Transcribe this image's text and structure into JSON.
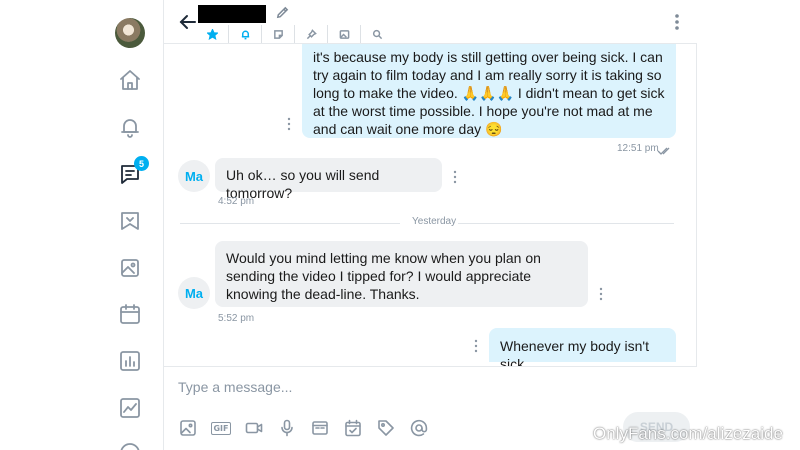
{
  "nav": {
    "badge_count": "5",
    "items": [
      "home-icon",
      "bell-icon",
      "messages-icon",
      "collections-icon",
      "vault-icon",
      "queue-icon",
      "statistics-icon",
      "growth-icon",
      "more-icon"
    ]
  },
  "header": {
    "tools": [
      "star-icon",
      "bell-icon",
      "note-icon",
      "pin-icon",
      "image-icon",
      "search-icon"
    ]
  },
  "messages": {
    "m1_text": "it's because my body is still getting over being sick. I can try again to film today and I am really sorry it is taking so long to make the video. 🙏🙏🙏 I didn't mean to get sick at the worst time possible. I hope you're not mad at me and can wait one more day 😔",
    "m1_time": "12:51 pm",
    "m2_avatar": "Ma",
    "m2_text": "Uh ok… so you will send tomorrow?",
    "m2_time": "4:52 pm",
    "separator": "Yesterday",
    "m3_avatar": "Ma",
    "m3_text": "Would you mind letting me know when you plan on sending the video I tipped for? I would appreciate knowing the dead-line. Thanks.",
    "m3_time": "5:52 pm",
    "m4_text": "Whenever my body isn't sick"
  },
  "composer": {
    "placeholder": "Type a message...",
    "send_label": "SEND",
    "gif_label": "GIF",
    "tools": [
      "image-icon",
      "gif-icon",
      "video-icon",
      "microphone-icon",
      "vault-icon",
      "schedule-icon",
      "price-tag-icon",
      "mention-icon"
    ]
  },
  "watermark": "OnlyFans.com/alizezaide",
  "colors": {
    "accent": "#00aff0",
    "outgoing_bubble": "#dcf3fd",
    "incoming_bubble": "#eef0f2"
  }
}
